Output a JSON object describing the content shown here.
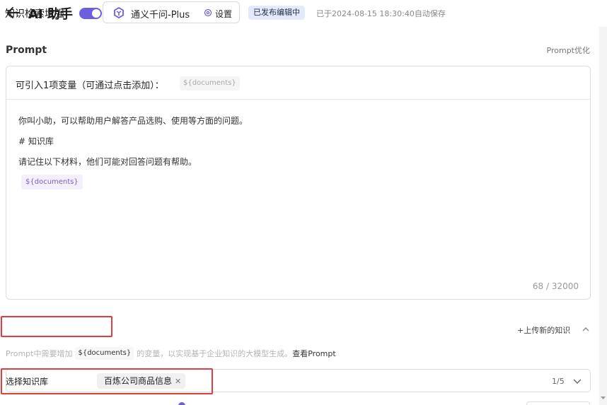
{
  "header": {
    "title": "AI 助手",
    "model_name": "通义千问-Plus",
    "settings_label": "设置",
    "status_badge": "已发布编辑中",
    "save_time": "已于2024-08-15 18:30:40自动保存"
  },
  "prompt": {
    "section_title": "Prompt",
    "optimize_label": "Prompt优化",
    "variable_label": "可引入1项变量（可通过点击添加）：",
    "variable_chip": "${documents}",
    "lines": [
      "你叫小助，可以帮助用户解答产品选购、使用等方面的问题。",
      "# 知识库",
      "请记住以下材料，他们可能对回答问题有帮助。"
    ],
    "inline_variable": "${documents}",
    "char_count": "68 / 32000"
  },
  "knowledge": {
    "title": "知识检索增强",
    "enabled": true,
    "upload_label": "+上传新的知识",
    "hint_prefix": "Prompt中需要增加",
    "hint_chip": "${documents}",
    "hint_suffix": "的变量，以实现基于企业知识的大模型生成。",
    "hint_link": "查看Prompt",
    "select_label": "选择知识库",
    "selected_tag": "百炼公司商品信息",
    "selected_count": "1/5"
  },
  "colors": {
    "accent": "#6d5ee0",
    "highlight_border": "#e23c3c",
    "badge_bg": "#e4eafb"
  }
}
